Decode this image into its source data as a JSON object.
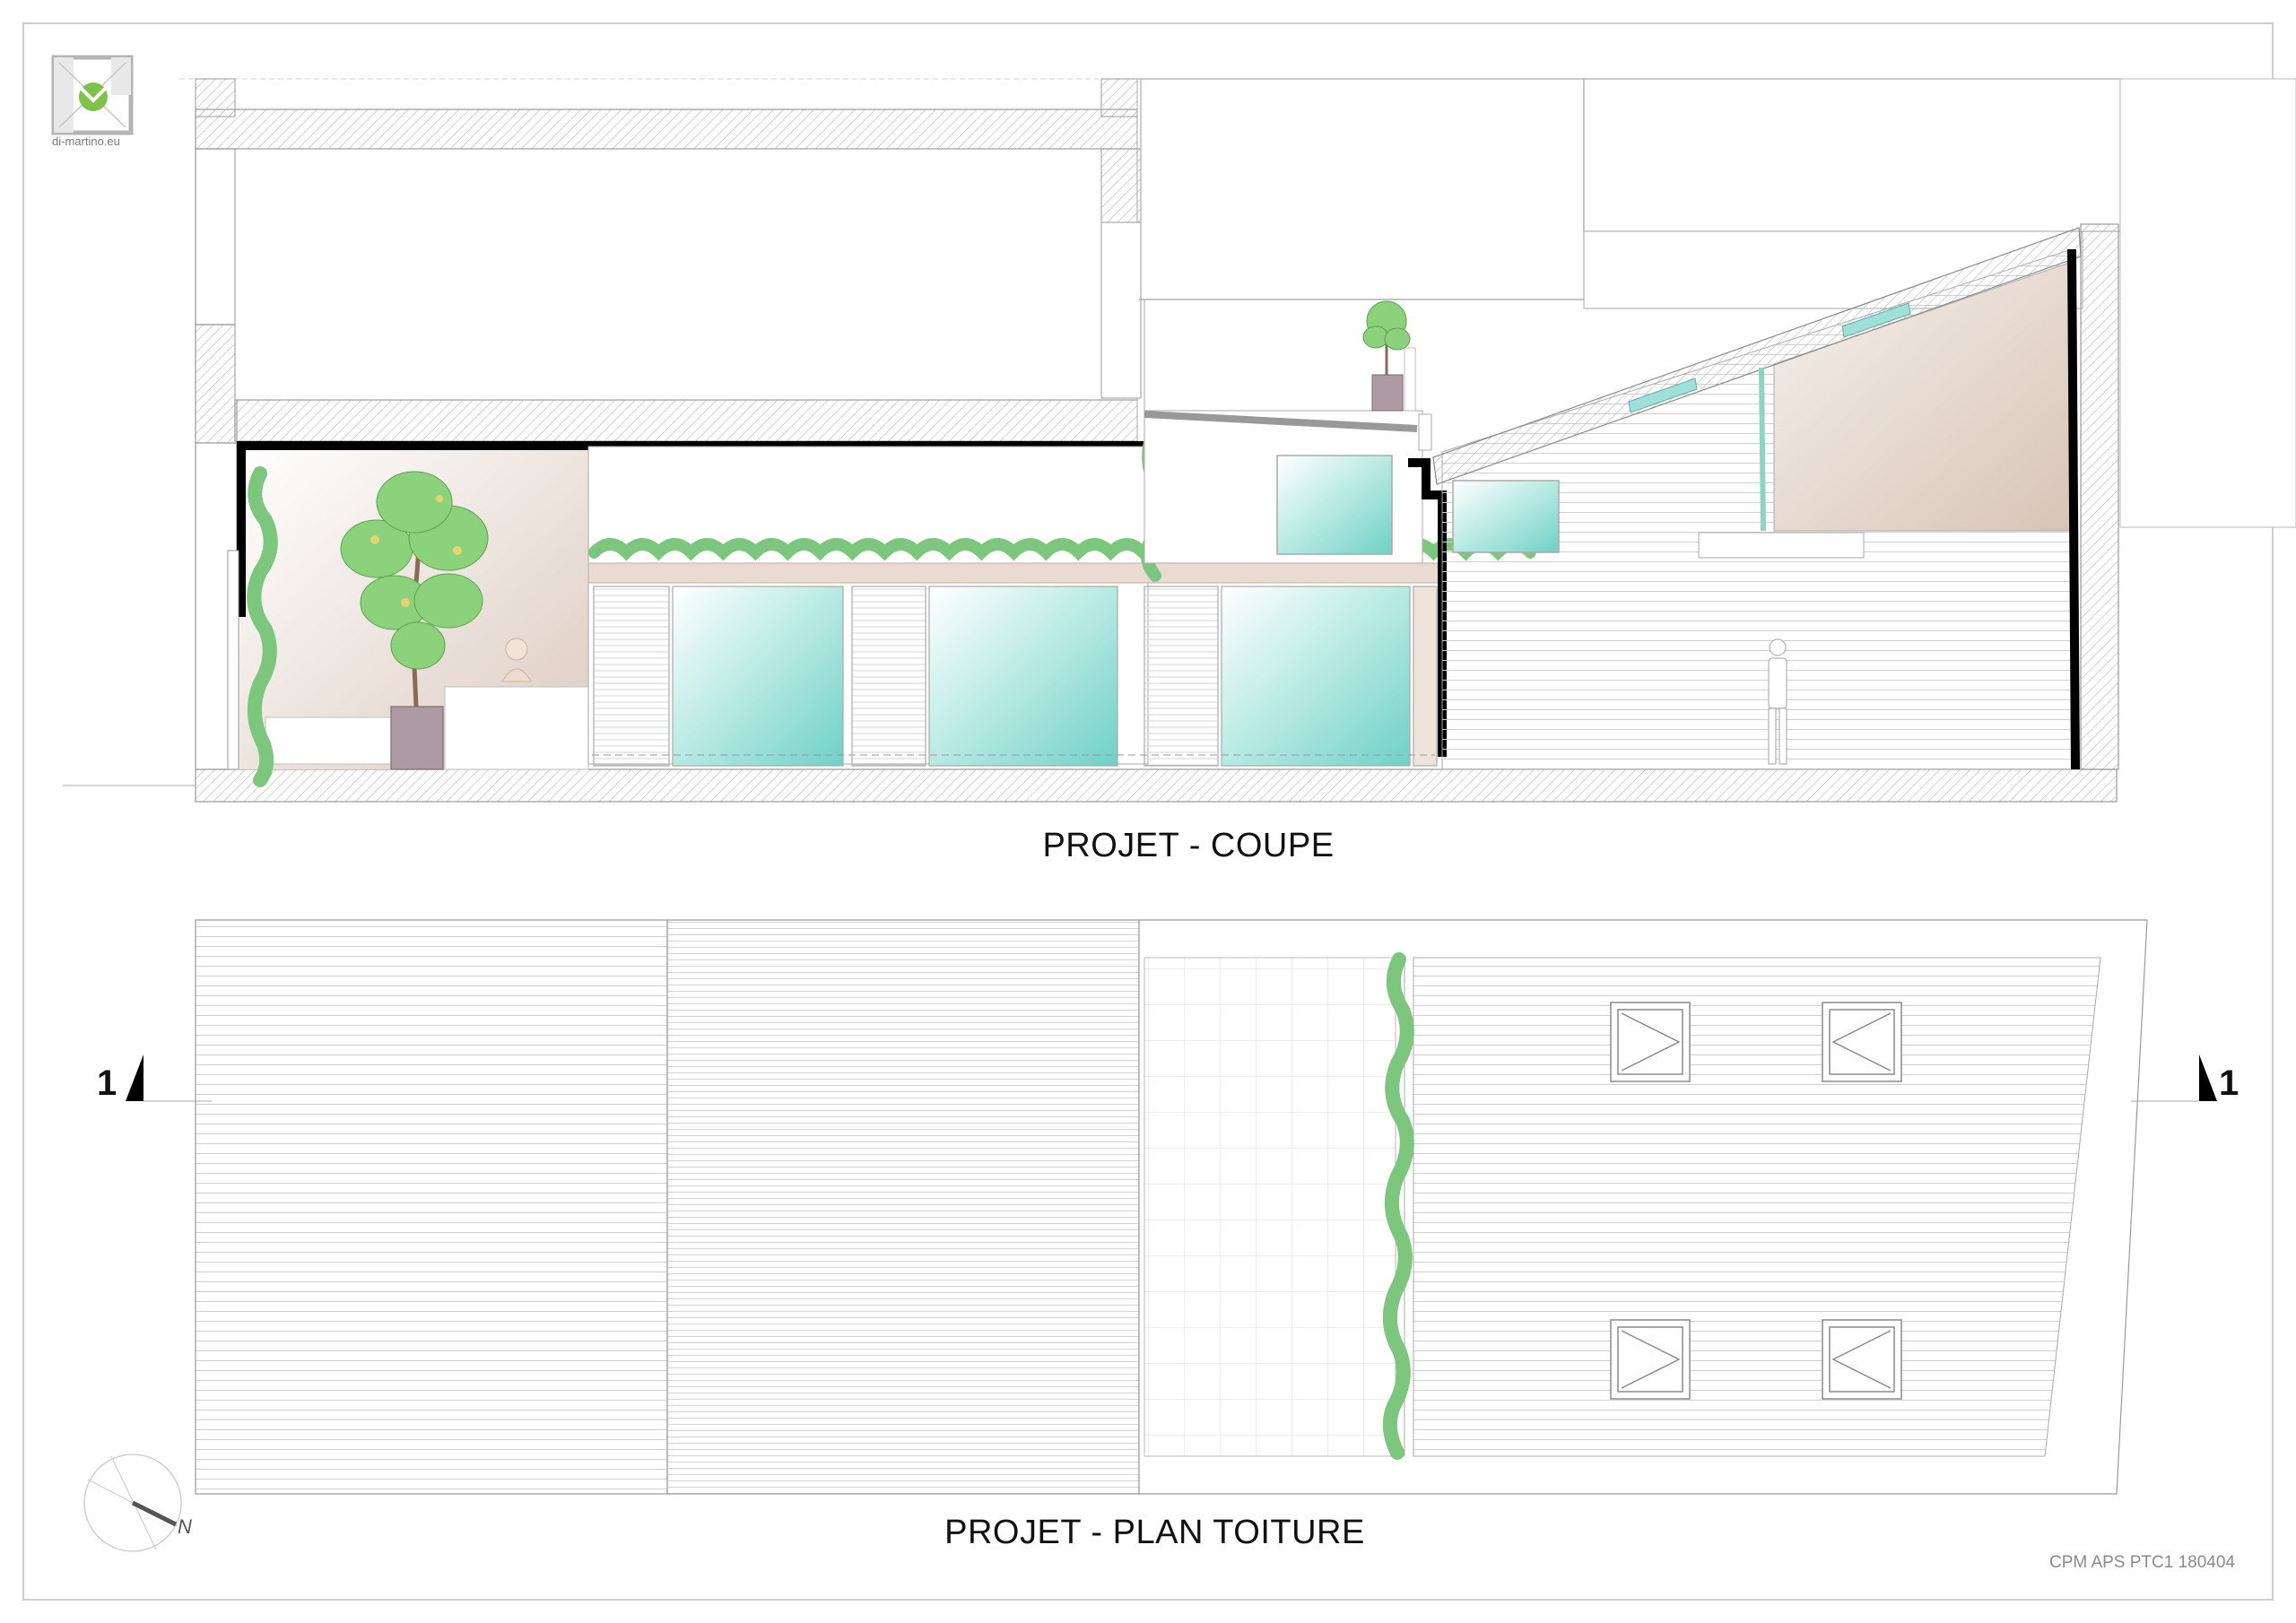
{
  "logo": {
    "icon": "di-martino-logo-icon",
    "text": "di-martino.eu"
  },
  "section": {
    "title": "PROJET - COUPE"
  },
  "roof_plan": {
    "title": "PROJET - PLAN TOITURE"
  },
  "cut_markers": {
    "left_label": "1",
    "right_label": "1"
  },
  "north_arrow": {
    "icon": "north-arrow-icon",
    "label": "N"
  },
  "reference": {
    "code": "CPM APS PTC1 180404"
  },
  "colors": {
    "glass": "#7fd8cf",
    "greenery": "#7cc67e",
    "planter": "#b09aa3",
    "interior_tint": "#e7dad0",
    "structure": "#000000",
    "hatch": "#9a9a9a"
  }
}
